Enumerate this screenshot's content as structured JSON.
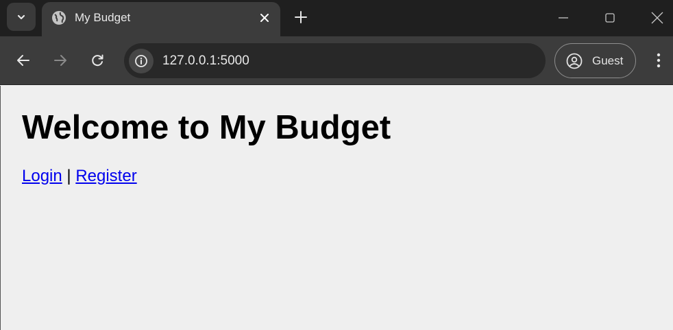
{
  "browser": {
    "tab": {
      "title": "My Budget",
      "favicon": "globe-icon"
    },
    "address_bar": {
      "url": "127.0.0.1:5000"
    },
    "profile": {
      "label": "Guest"
    }
  },
  "page": {
    "heading": "Welcome to My Budget",
    "links": {
      "login": "Login",
      "separator": "|",
      "register": "Register"
    }
  },
  "colors": {
    "tabstrip": "#1f1f1f",
    "toolbar": "#3c3c3c",
    "page_background": "#efefef",
    "link": "#0000ee"
  }
}
